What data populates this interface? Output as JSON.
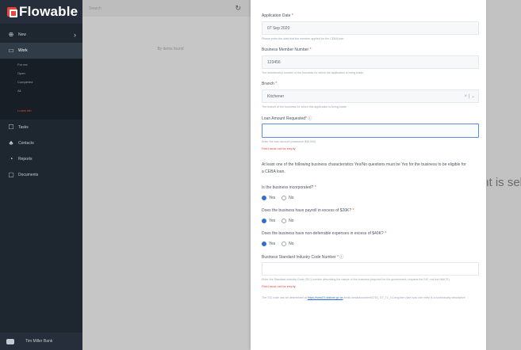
{
  "sidebar": {
    "logo": "Flowable",
    "items": [
      {
        "label": "New",
        "icon": "plus-circle-icon"
      },
      {
        "label": "Work",
        "icon": "inbox-icon"
      }
    ],
    "sub_items": [
      "For me",
      "Open",
      "Completed",
      "All",
      "Loans tab"
    ],
    "items_bottom": [
      {
        "label": "Tasks",
        "icon": "tasks-icon"
      },
      {
        "label": "Contacts",
        "icon": "contacts-icon"
      },
      {
        "label": "Reports",
        "icon": "reports-icon"
      },
      {
        "label": "Documents",
        "icon": "documents-icon"
      }
    ],
    "user": "Tim Miller Bank"
  },
  "list": {
    "search_placeholder": "Search",
    "sort_label": "By items found"
  },
  "background_text": "nt is sel",
  "form": {
    "application_date_label": "Application Date",
    "application_date_value": "07 Sep 2020",
    "application_date_hint": "Please enter the date that the member applied for the CEBA loan",
    "member_number_label": "Business Member Number",
    "member_number_value": "123456",
    "member_number_hint": "The membership number of the business for which the application is being made",
    "branch_label": "Branch",
    "branch_value": "Kitchener",
    "branch_hint": "The branch of the business for which this application is being made",
    "loan_amount_label": "Loan Amount Requested",
    "loan_amount_value": "",
    "loan_amount_hint": "Enter the loan amount (maximum $40,000)",
    "loan_amount_error": "Field must not be empty",
    "intro_paragraph": "At least one of the following business characteristics Yes/No questions must be Yes for the business to be eligible for a CEBA loan.",
    "q1_label": "Is the business incorporated?",
    "q2_label": "Does the business have payroll in excess of $20K?",
    "q3_label": "Does the business have non-deferrable expenses in excess of $40K?",
    "yes": "Yes",
    "no": "No",
    "sic_label": "Business Standard Industry Code Number",
    "sic_value": "",
    "sic_hint": "Enter the Standard Industry Code (SIC) number describing the nature of the business (required for the government, requires the SIC, not the NAICS).",
    "sic_error": "Field must not be empty",
    "sic_note_prefix": "The SIC code can be determined at",
    "sic_note_link": "https://www23.statcan.gc.ca",
    "sic_note_suffix": "/imdb-bmdi/document/3701_D7_T1_V1-eng.htm (see how one entry is a contextually descriptive"
  }
}
